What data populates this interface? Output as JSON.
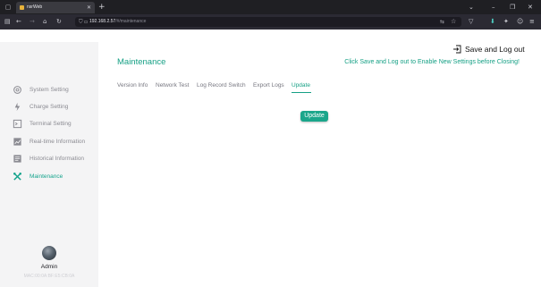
{
  "browser": {
    "tab_title": "nsrWeb",
    "url_host": "192.168.2.57",
    "url_path": "/#/maintenance"
  },
  "sidebar": {
    "items": [
      {
        "label": "System Setting",
        "icon": "gear-icon"
      },
      {
        "label": "Charge Setting",
        "icon": "charge-icon"
      },
      {
        "label": "Terminal Setting",
        "icon": "terminal-icon"
      },
      {
        "label": "Real-time Information",
        "icon": "chart-icon"
      },
      {
        "label": "Historical Information",
        "icon": "history-icon"
      },
      {
        "label": "Maintenance",
        "icon": "tools-icon",
        "active": true
      }
    ],
    "user": "Admin",
    "mac": "MAC:00:0A:BF:E5:CB:0A"
  },
  "header": {
    "title": "Maintenance",
    "save_logout": "Save and Log out",
    "notice": "Click Save and Log out to Enable New Settings before Closing!"
  },
  "tabs": [
    {
      "label": "Version Info"
    },
    {
      "label": "Network Test"
    },
    {
      "label": "Log Record Switch"
    },
    {
      "label": "Export Logs"
    },
    {
      "label": "Update",
      "active": true
    }
  ],
  "content": {
    "update_button": "Update"
  },
  "colors": {
    "accent": "#16a085",
    "sidebar_bg": "#f4f4f5",
    "chrome_bg": "#1f1f23"
  }
}
